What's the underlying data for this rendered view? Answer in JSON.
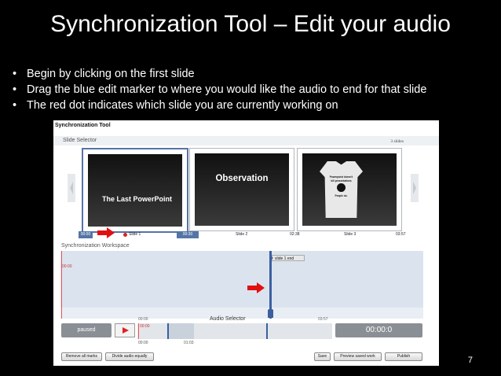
{
  "slide": {
    "title": "Synchronization Tool – Edit your audio",
    "bullets": [
      "Begin by clicking on the first slide",
      "Drag the blue edit marker to where you would like the audio to end for that slide",
      "The red dot indicates which slide you are currently working on"
    ],
    "page_number": "7"
  },
  "tool": {
    "title": "Synchronization Tool",
    "slide_selector": {
      "label": "Slide Selector",
      "count": "3 slides",
      "slides": [
        {
          "label": "Slide 1",
          "start": "00:00",
          "end": "00:30",
          "thumb_text": "The Last PowerPoint",
          "selected": true
        },
        {
          "label": "Slide 2",
          "end": "02:38",
          "thumb_text": "Observation"
        },
        {
          "label": "Slide 3",
          "end": "03:57",
          "thumb_text": [
            "Powerpoint doesn't",
            "kill presentations",
            "People do."
          ]
        }
      ]
    },
    "workspace": {
      "label": "Synchronization Workspace",
      "start_time": "00:00",
      "marker_label": "slide 1   end"
    },
    "audio_selector": {
      "label": "Audio Selector",
      "start": "00:00",
      "end": "03:57",
      "marker_time": "00:00",
      "sub_start": "00:00",
      "sub_mark": "01:03",
      "status": "paused",
      "current_time": "00:00:0"
    },
    "buttons": {
      "remove_all_marks": "Remove all marks",
      "divide_audio_equally": "Divide audio equally",
      "save": "Save",
      "preview_saved_work": "Preview saved work",
      "publish": "Publish"
    }
  },
  "colors": {
    "accent_blue": "#5574a6",
    "marker_blue": "#3b5fa0",
    "red": "#d22222"
  }
}
